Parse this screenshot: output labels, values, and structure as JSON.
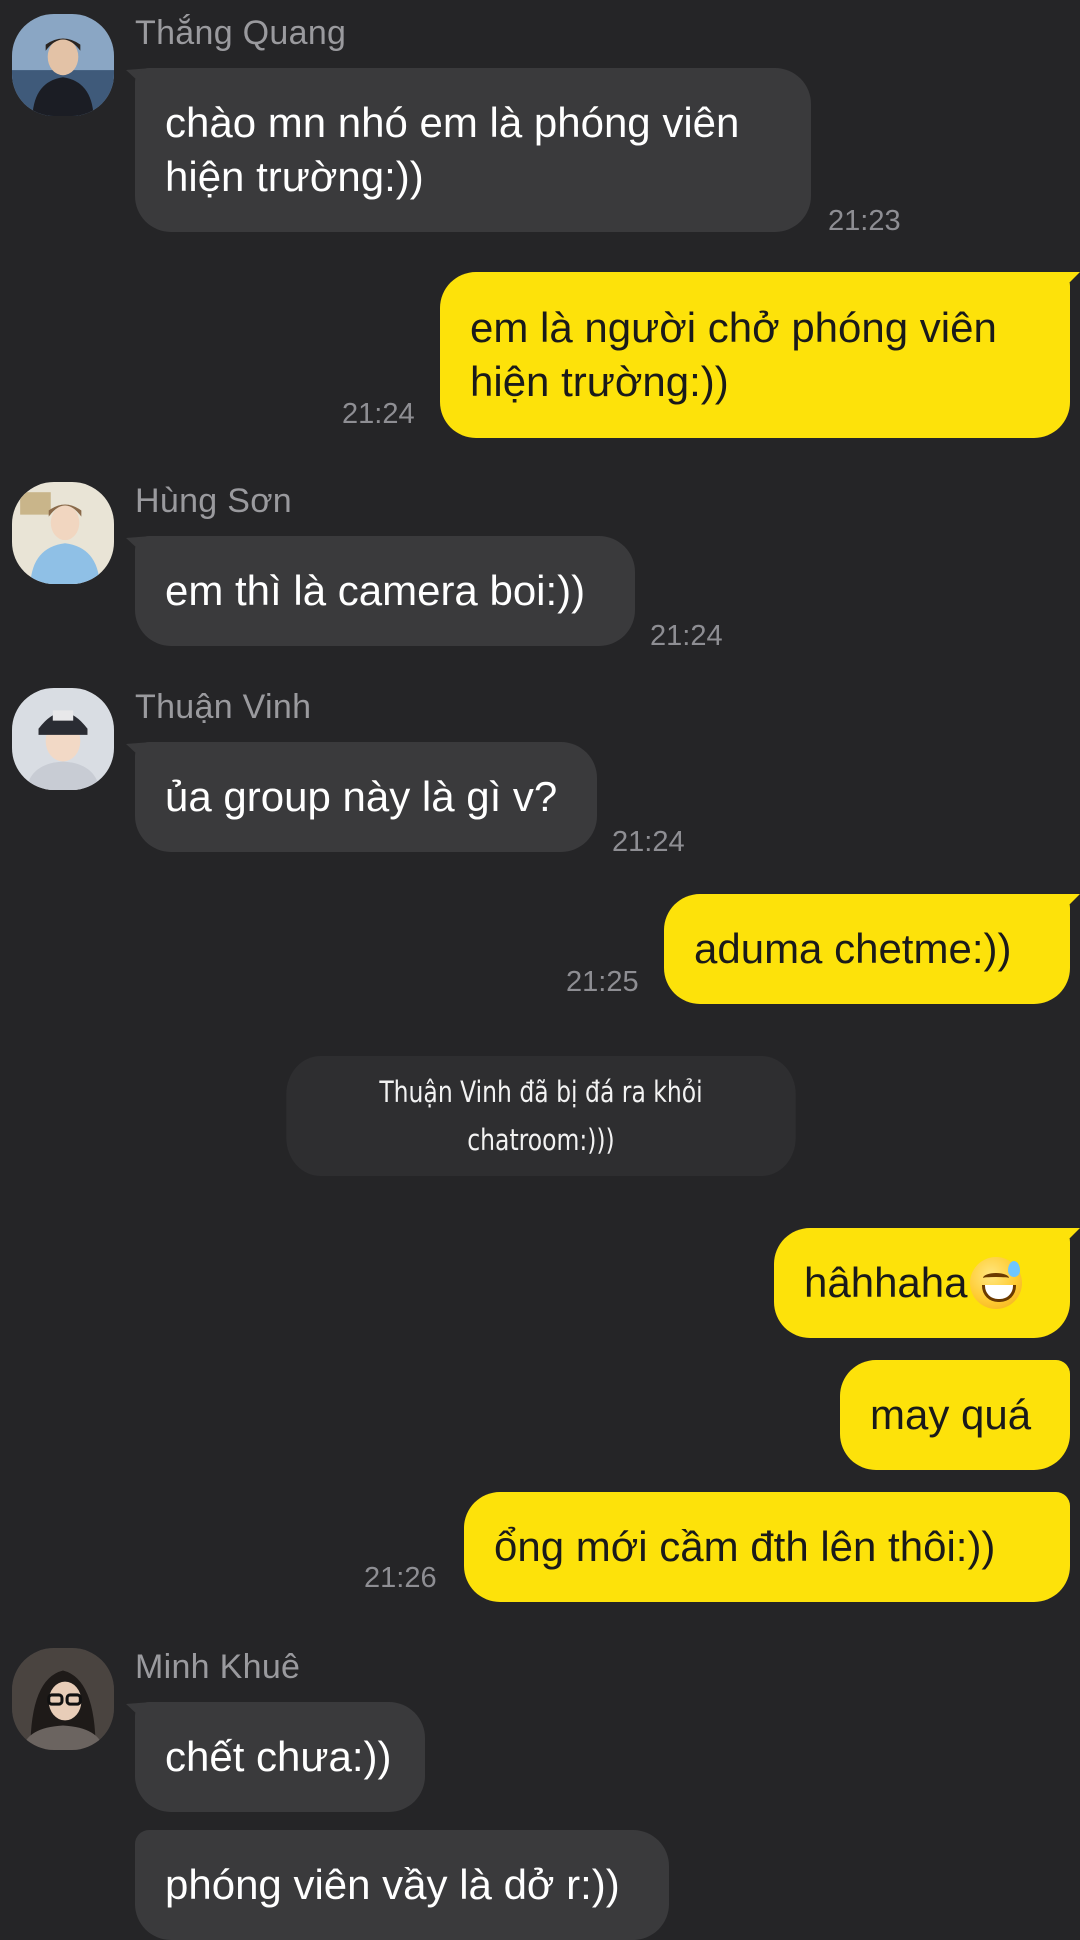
{
  "chat": {
    "messages": [
      {
        "sender": "Thắng Quang",
        "text": "chào mn nhó em là phóng viên\nhiện trường:))",
        "time": "21:23"
      },
      {
        "text": "em là người chở phóng viên\nhiện trường:))",
        "time": "21:24"
      },
      {
        "sender": "Hùng Sơn",
        "text": "em thì là camera boi:))",
        "time": "21:24"
      },
      {
        "sender": "Thuận Vinh",
        "text": "ủa group này là gì v?",
        "time": "21:24"
      },
      {
        "text": "aduma chetme:))",
        "time": "21:25"
      },
      {
        "notice": "Thuận Vinh đã bị đá ra khỏi\nchatroom:)))"
      },
      {
        "text": "hâhhaha",
        "emoji": "sweat-smile-emoji"
      },
      {
        "text": "may quá"
      },
      {
        "text": "ổng mới cầm đth lên thôi:))",
        "time": "21:26"
      },
      {
        "sender": "Minh Khuê",
        "text": "chết chưa:))"
      },
      {
        "text": "phóng viên vầy là dở r:))"
      }
    ]
  },
  "colors": {
    "background": "#252527",
    "incoming_bubble": "#3a3a3c",
    "outgoing_bubble": "#fde20a",
    "meta_text": "#8e8e93"
  }
}
